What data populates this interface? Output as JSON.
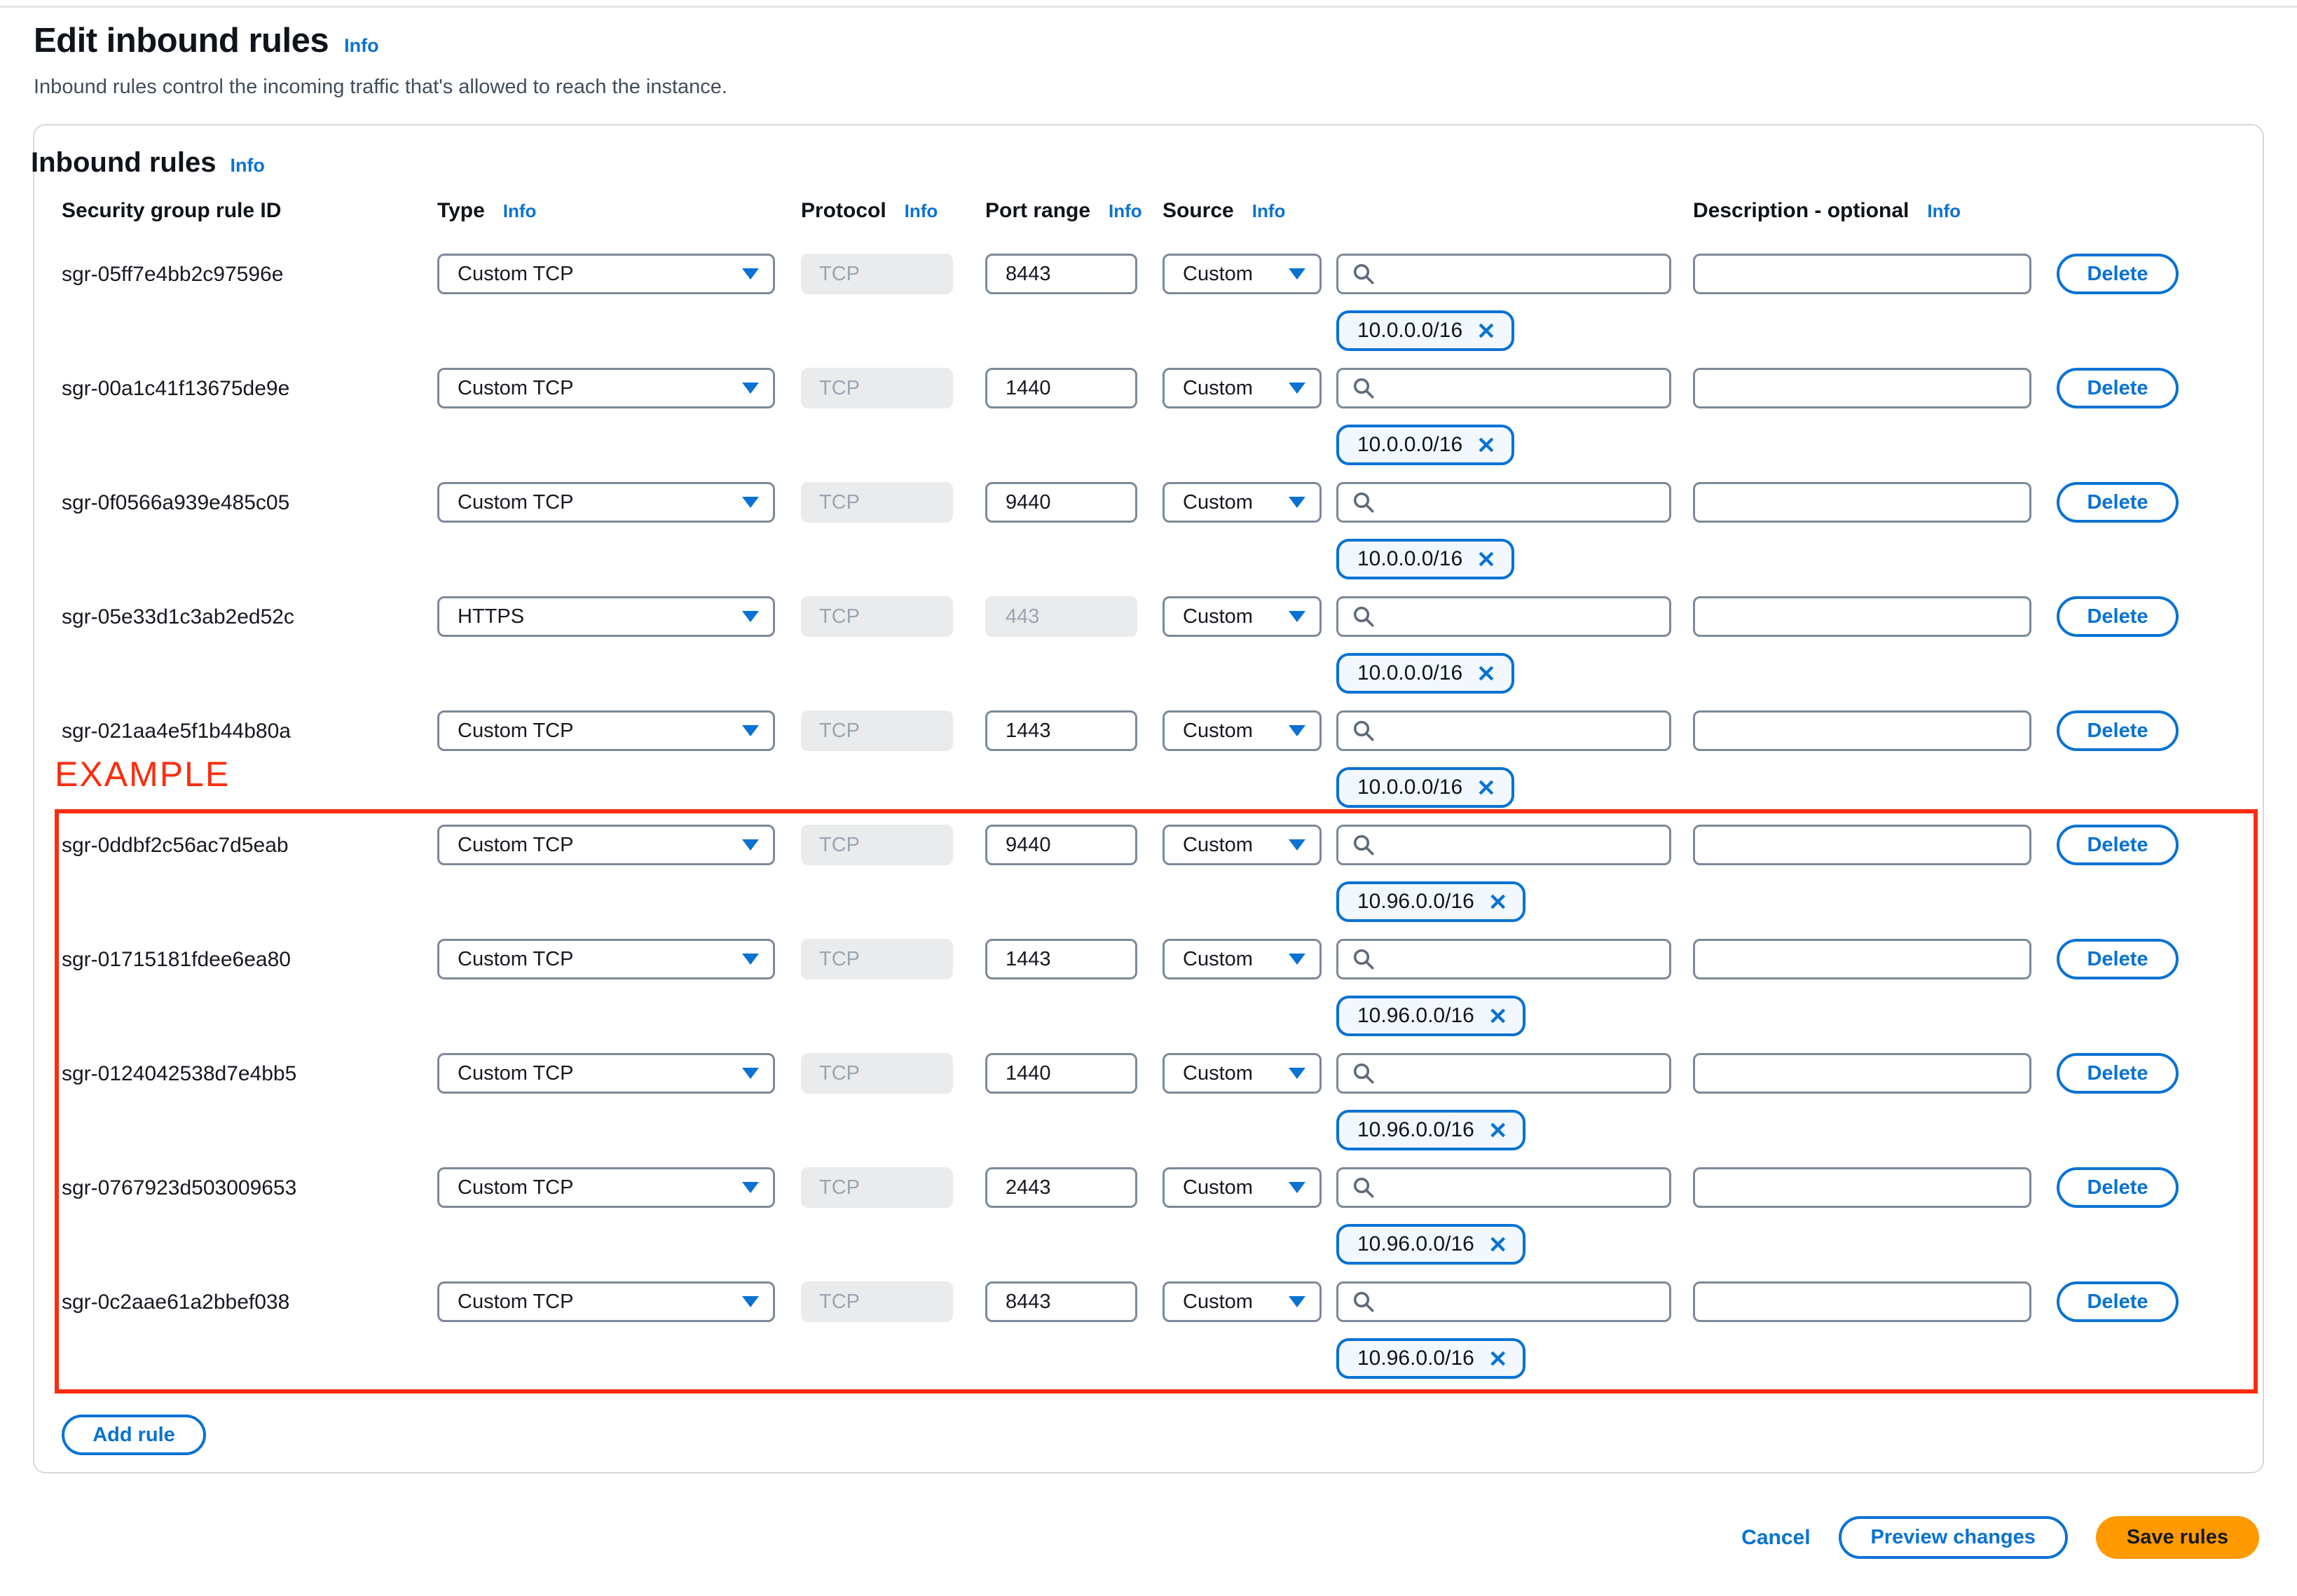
{
  "page": {
    "title": "Edit inbound rules",
    "subtitle": "Inbound rules control the incoming traffic that's allowed to reach the instance."
  },
  "shared": {
    "info_label": "Info"
  },
  "panel": {
    "heading": "Inbound rules",
    "columns": {
      "rule_id": "Security group rule ID",
      "type": "Type",
      "protocol": "Protocol",
      "port_range": "Port range",
      "source": "Source",
      "description": "Description - optional"
    },
    "delete_label": "Delete",
    "add_rule_label": "Add rule",
    "rows": [
      {
        "id": "sgr-05ff7e4bb2c97596e",
        "type": "Custom TCP",
        "protocol": "TCP",
        "port": "8443",
        "port_disabled": false,
        "source_mode": "Custom",
        "cidr": "10.0.0.0/16",
        "example": false
      },
      {
        "id": "sgr-00a1c41f13675de9e",
        "type": "Custom TCP",
        "protocol": "TCP",
        "port": "1440",
        "port_disabled": false,
        "source_mode": "Custom",
        "cidr": "10.0.0.0/16",
        "example": false
      },
      {
        "id": "sgr-0f0566a939e485c05",
        "type": "Custom TCP",
        "protocol": "TCP",
        "port": "9440",
        "port_disabled": false,
        "source_mode": "Custom",
        "cidr": "10.0.0.0/16",
        "example": false
      },
      {
        "id": "sgr-05e33d1c3ab2ed52c",
        "type": "HTTPS",
        "protocol": "TCP",
        "port": "443",
        "port_disabled": true,
        "source_mode": "Custom",
        "cidr": "10.0.0.0/16",
        "example": false
      },
      {
        "id": "sgr-021aa4e5f1b44b80a",
        "type": "Custom TCP",
        "protocol": "TCP",
        "port": "1443",
        "port_disabled": false,
        "source_mode": "Custom",
        "cidr": "10.0.0.0/16",
        "example": false
      },
      {
        "id": "sgr-0ddbf2c56ac7d5eab",
        "type": "Custom TCP",
        "protocol": "TCP",
        "port": "9440",
        "port_disabled": false,
        "source_mode": "Custom",
        "cidr": "10.96.0.0/16",
        "example": true
      },
      {
        "id": "sgr-01715181fdee6ea80",
        "type": "Custom TCP",
        "protocol": "TCP",
        "port": "1443",
        "port_disabled": false,
        "source_mode": "Custom",
        "cidr": "10.96.0.0/16",
        "example": true
      },
      {
        "id": "sgr-0124042538d7e4bb5",
        "type": "Custom TCP",
        "protocol": "TCP",
        "port": "1440",
        "port_disabled": false,
        "source_mode": "Custom",
        "cidr": "10.96.0.0/16",
        "example": true
      },
      {
        "id": "sgr-0767923d503009653",
        "type": "Custom TCP",
        "protocol": "TCP",
        "port": "2443",
        "port_disabled": false,
        "source_mode": "Custom",
        "cidr": "10.96.0.0/16",
        "example": true
      },
      {
        "id": "sgr-0c2aae61a2bbef038",
        "type": "Custom TCP",
        "protocol": "TCP",
        "port": "8443",
        "port_disabled": false,
        "source_mode": "Custom",
        "cidr": "10.96.0.0/16",
        "example": true
      }
    ]
  },
  "annotation": {
    "label": "EXAMPLE"
  },
  "footer": {
    "cancel": "Cancel",
    "preview": "Preview changes",
    "save": "Save rules"
  },
  "icons": {
    "close": "✕"
  },
  "colors": {
    "accent_blue": "#0972d3",
    "primary_orange": "#ff9900",
    "annotation_red": "#fb2d10",
    "chip_background": "#f2f8fd",
    "disabled_background": "#e9ebed",
    "input_border": "#7d8998"
  }
}
